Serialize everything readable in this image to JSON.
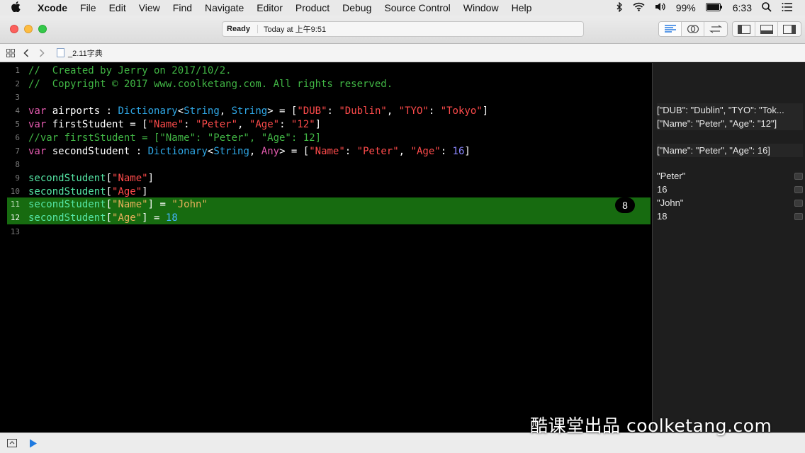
{
  "menubar": {
    "apple_icon": "apple-icon",
    "items": [
      "Xcode",
      "File",
      "Edit",
      "View",
      "Find",
      "Navigate",
      "Editor",
      "Product",
      "Debug",
      "Source Control",
      "Window",
      "Help"
    ],
    "battery": "99%",
    "clock": "6:33"
  },
  "toolbar": {
    "status": "Ready",
    "time": "Today at 上午9:51"
  },
  "jumpbar": {
    "file_name": "_2.11字典"
  },
  "editor": {
    "lines": [
      {
        "num": "1"
      },
      {
        "num": "2"
      },
      {
        "num": "3"
      },
      {
        "num": "4"
      },
      {
        "num": "5"
      },
      {
        "num": "6"
      },
      {
        "num": "7"
      },
      {
        "num": "8"
      },
      {
        "num": "9"
      },
      {
        "num": "10"
      },
      {
        "num": "11"
      },
      {
        "num": "12"
      },
      {
        "num": "13"
      }
    ],
    "badge": "8"
  },
  "results": [
    "[\"DUB\": \"Dublin\", \"TYO\": \"Tok...",
    "[\"Name\": \"Peter\", \"Age\": \"12\"]",
    "[\"Name\": \"Peter\", \"Age\": 16]",
    "\"Peter\"",
    "16",
    "\"John\"",
    "18"
  ],
  "watermark": "酷课堂出品 coolketang.com",
  "colors": {
    "highlight": "#176b10",
    "comment": "#41b645",
    "keyword": "#e55bb0",
    "type": "#2fa8e7",
    "string": "#ff4b4b",
    "number": "#8b87ff"
  }
}
